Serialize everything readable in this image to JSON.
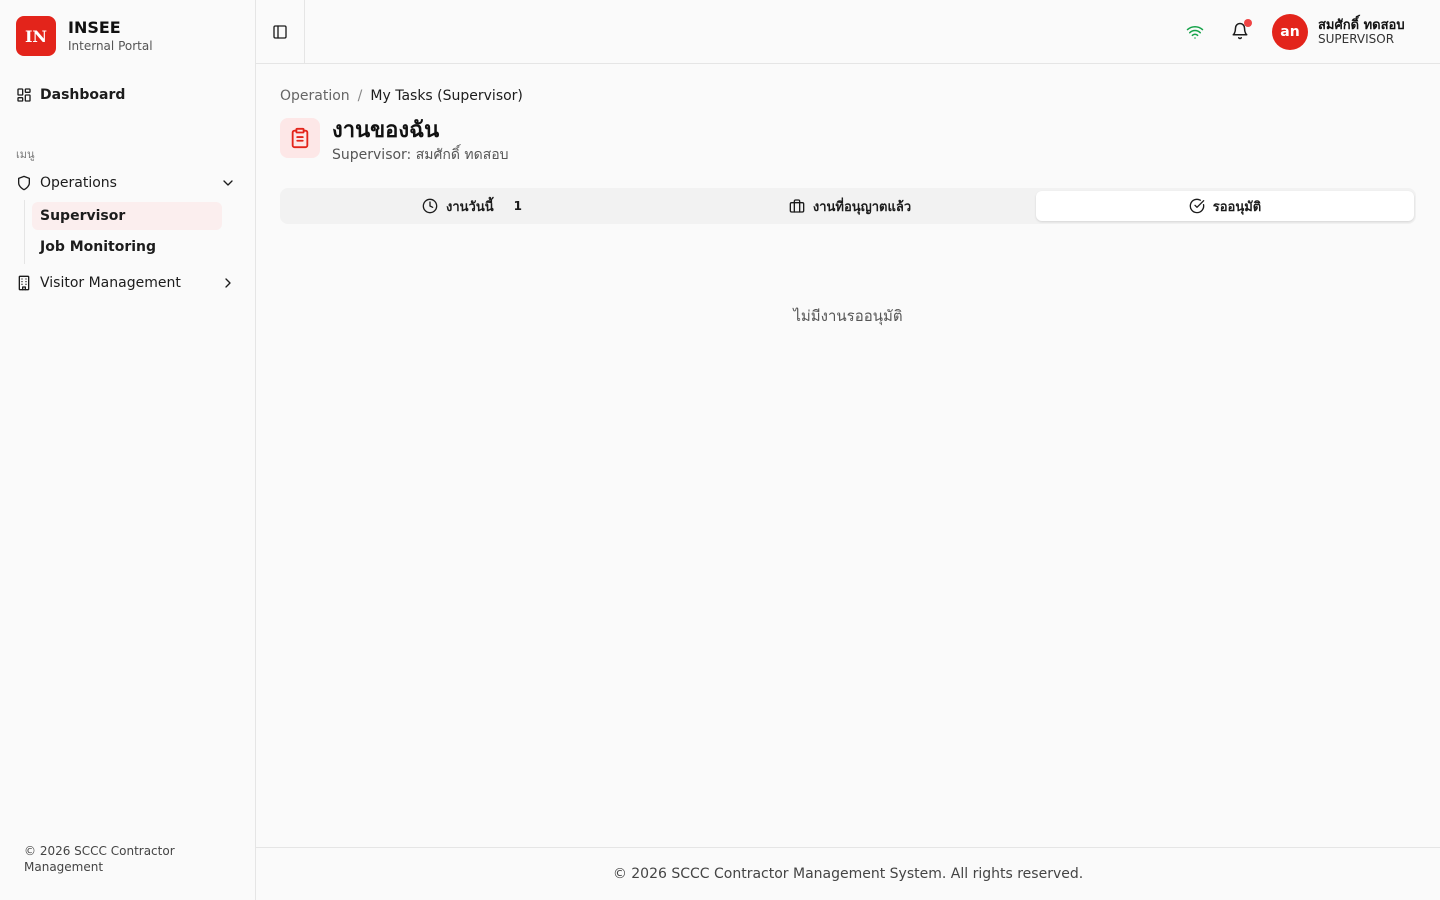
{
  "brand": {
    "logo_text": "IN",
    "name": "INSEE",
    "subtitle": "Internal Portal"
  },
  "sidebar": {
    "dashboard_label": "Dashboard",
    "menu_label": "เมนู",
    "operations_label": "Operations",
    "sub_items": [
      {
        "label": "Supervisor",
        "active": true
      },
      {
        "label": "Job Monitoring",
        "active": false
      }
    ],
    "visitor_label": "Visitor Management",
    "footer": "© 2026 SCCC Contractor Management"
  },
  "header": {
    "avatar_initials": "an",
    "user_name": "สมศักดิ์ ทดสอบ",
    "user_role": "SUPERVISOR",
    "bell_badge_color": "#ef4444",
    "wifi_color": "#16a34a"
  },
  "breadcrumb": {
    "parent": "Operation",
    "separator": "/",
    "current": "My Tasks (Supervisor)"
  },
  "page": {
    "title": "งานของฉัน",
    "subtitle": "Supervisor: สมศักดิ์ ทดสอบ"
  },
  "tabs": [
    {
      "label": "งานวันนี้",
      "count": "1",
      "icon": "clock-icon",
      "active": false
    },
    {
      "label": "งานที่อนุญาตแล้ว",
      "icon": "briefcase-icon",
      "active": false
    },
    {
      "label": "รออนุมัติ",
      "icon": "check-circle-icon",
      "active": true
    }
  ],
  "empty_message": "ไม่มีงานรออนุมัติ",
  "footer": "© 2026 SCCC Contractor Management System. All rights reserved.",
  "colors": {
    "accent": "#e3241b",
    "active_bg": "#fbeeee",
    "title_icon_bg": "#fde7e7"
  }
}
